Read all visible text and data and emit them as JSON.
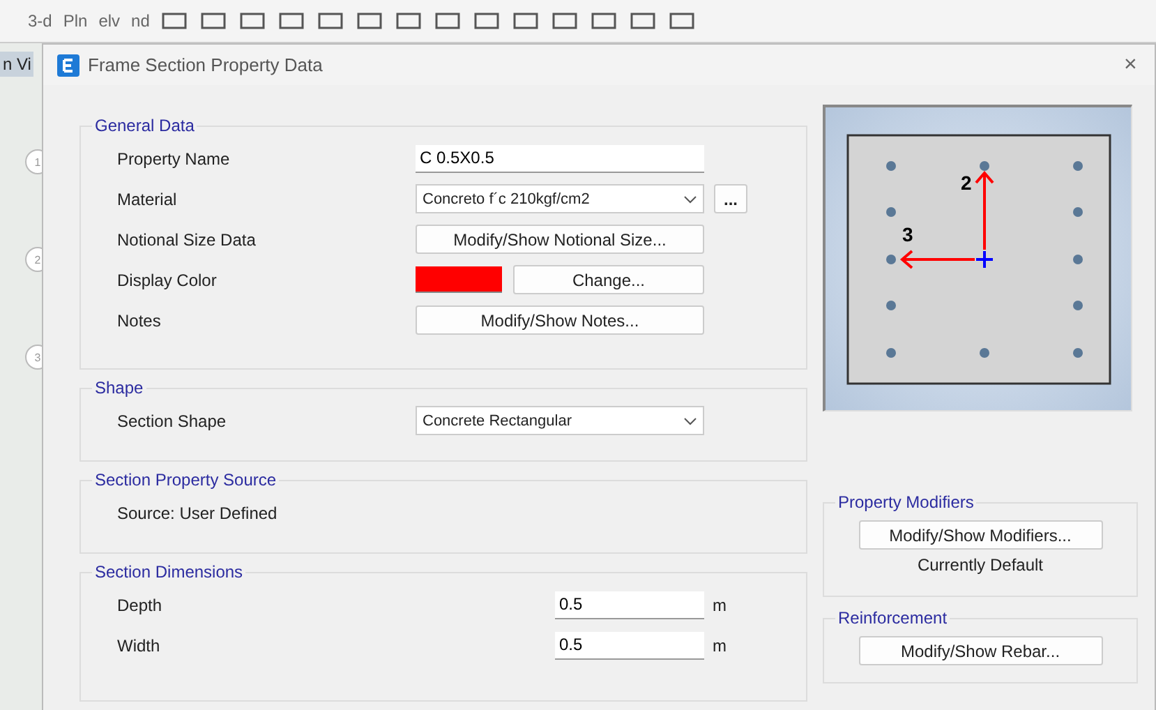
{
  "toolbar": {
    "labels": [
      "3-d",
      "Pln",
      "elv",
      "nd"
    ]
  },
  "side_tab": {
    "label": "n Vi"
  },
  "grid_bubbles": [
    "1",
    "2",
    "3"
  ],
  "window": {
    "title": "Frame Section Property Data",
    "close": "×"
  },
  "general_data": {
    "title": "General Data",
    "property_name": {
      "label": "Property Name",
      "value": "C 0.5X0.5"
    },
    "material": {
      "label": "Material",
      "value": "Concreto f´c 210kgf/cm2",
      "more": "..."
    },
    "notional_size": {
      "label": "Notional Size Data",
      "button": "Modify/Show Notional Size..."
    },
    "display_color": {
      "label": "Display Color",
      "color": "#ff0000",
      "button": "Change..."
    },
    "notes": {
      "label": "Notes",
      "button": "Modify/Show Notes..."
    }
  },
  "shape": {
    "title": "Shape",
    "label": "Section Shape",
    "value": "Concrete Rectangular"
  },
  "source": {
    "title": "Section Property Source",
    "text": "Source:  User Defined"
  },
  "dimensions": {
    "title": "Section Dimensions",
    "rows": [
      {
        "label": "Depth",
        "value": "0.5",
        "unit": "m"
      },
      {
        "label": "Width",
        "value": "0.5",
        "unit": "m"
      }
    ]
  },
  "preview": {
    "axis_2": "2",
    "axis_3": "3"
  },
  "property_modifiers": {
    "title": "Property Modifiers",
    "button": "Modify/Show Modifiers...",
    "status": "Currently Default"
  },
  "reinforcement": {
    "title": "Reinforcement",
    "button": "Modify/Show Rebar..."
  }
}
